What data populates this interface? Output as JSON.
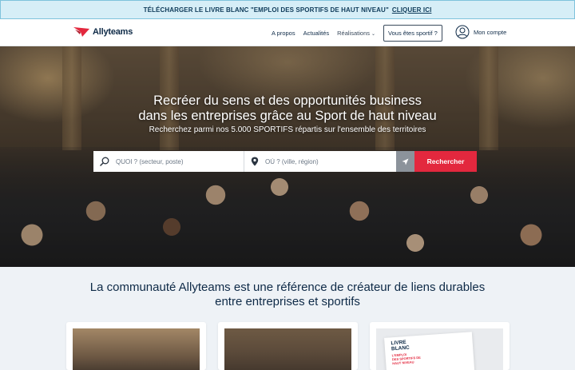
{
  "banner": {
    "text": "TÉLÉCHARGER LE LIVRE BLANC \"EMPLOI DES SPORTIFS DE HAUT NIVEAU\"",
    "link": "CLIQUER ICI"
  },
  "header": {
    "brand": "Allyteams",
    "nav": [
      {
        "label": "A propos"
      },
      {
        "label": "Actualités"
      },
      {
        "label": "Réalisations"
      }
    ],
    "cta": "Vous êtes sportif ?",
    "account": "Mon compte"
  },
  "hero": {
    "title_line1": "Recréer du sens et des opportunités business",
    "title_line2": "dans les entreprises grâce au Sport de haut niveau",
    "subtitle": "Recherchez parmi nos 5.000 SPORTIFS répartis sur l'ensemble des territoires"
  },
  "search": {
    "what_placeholder": "QUOI ? (secteur, poste)",
    "where_placeholder": "OÙ ? (ville, région)",
    "button": "Rechercher"
  },
  "section": {
    "title_line1": "La communauté Allyteams est une référence de créateur de liens durables",
    "title_line2": "entre entreprises et sportifs"
  },
  "cards": {
    "doc_title": "LIVRE\nBLANC",
    "doc_sub": "L'EMPLOI\nDES SPORTIFS DE\nHAUT NIVEAU"
  },
  "colors": {
    "brand_red": "#e3283e",
    "navy": "#0e2a47",
    "banner_bg": "#d6eef7"
  }
}
